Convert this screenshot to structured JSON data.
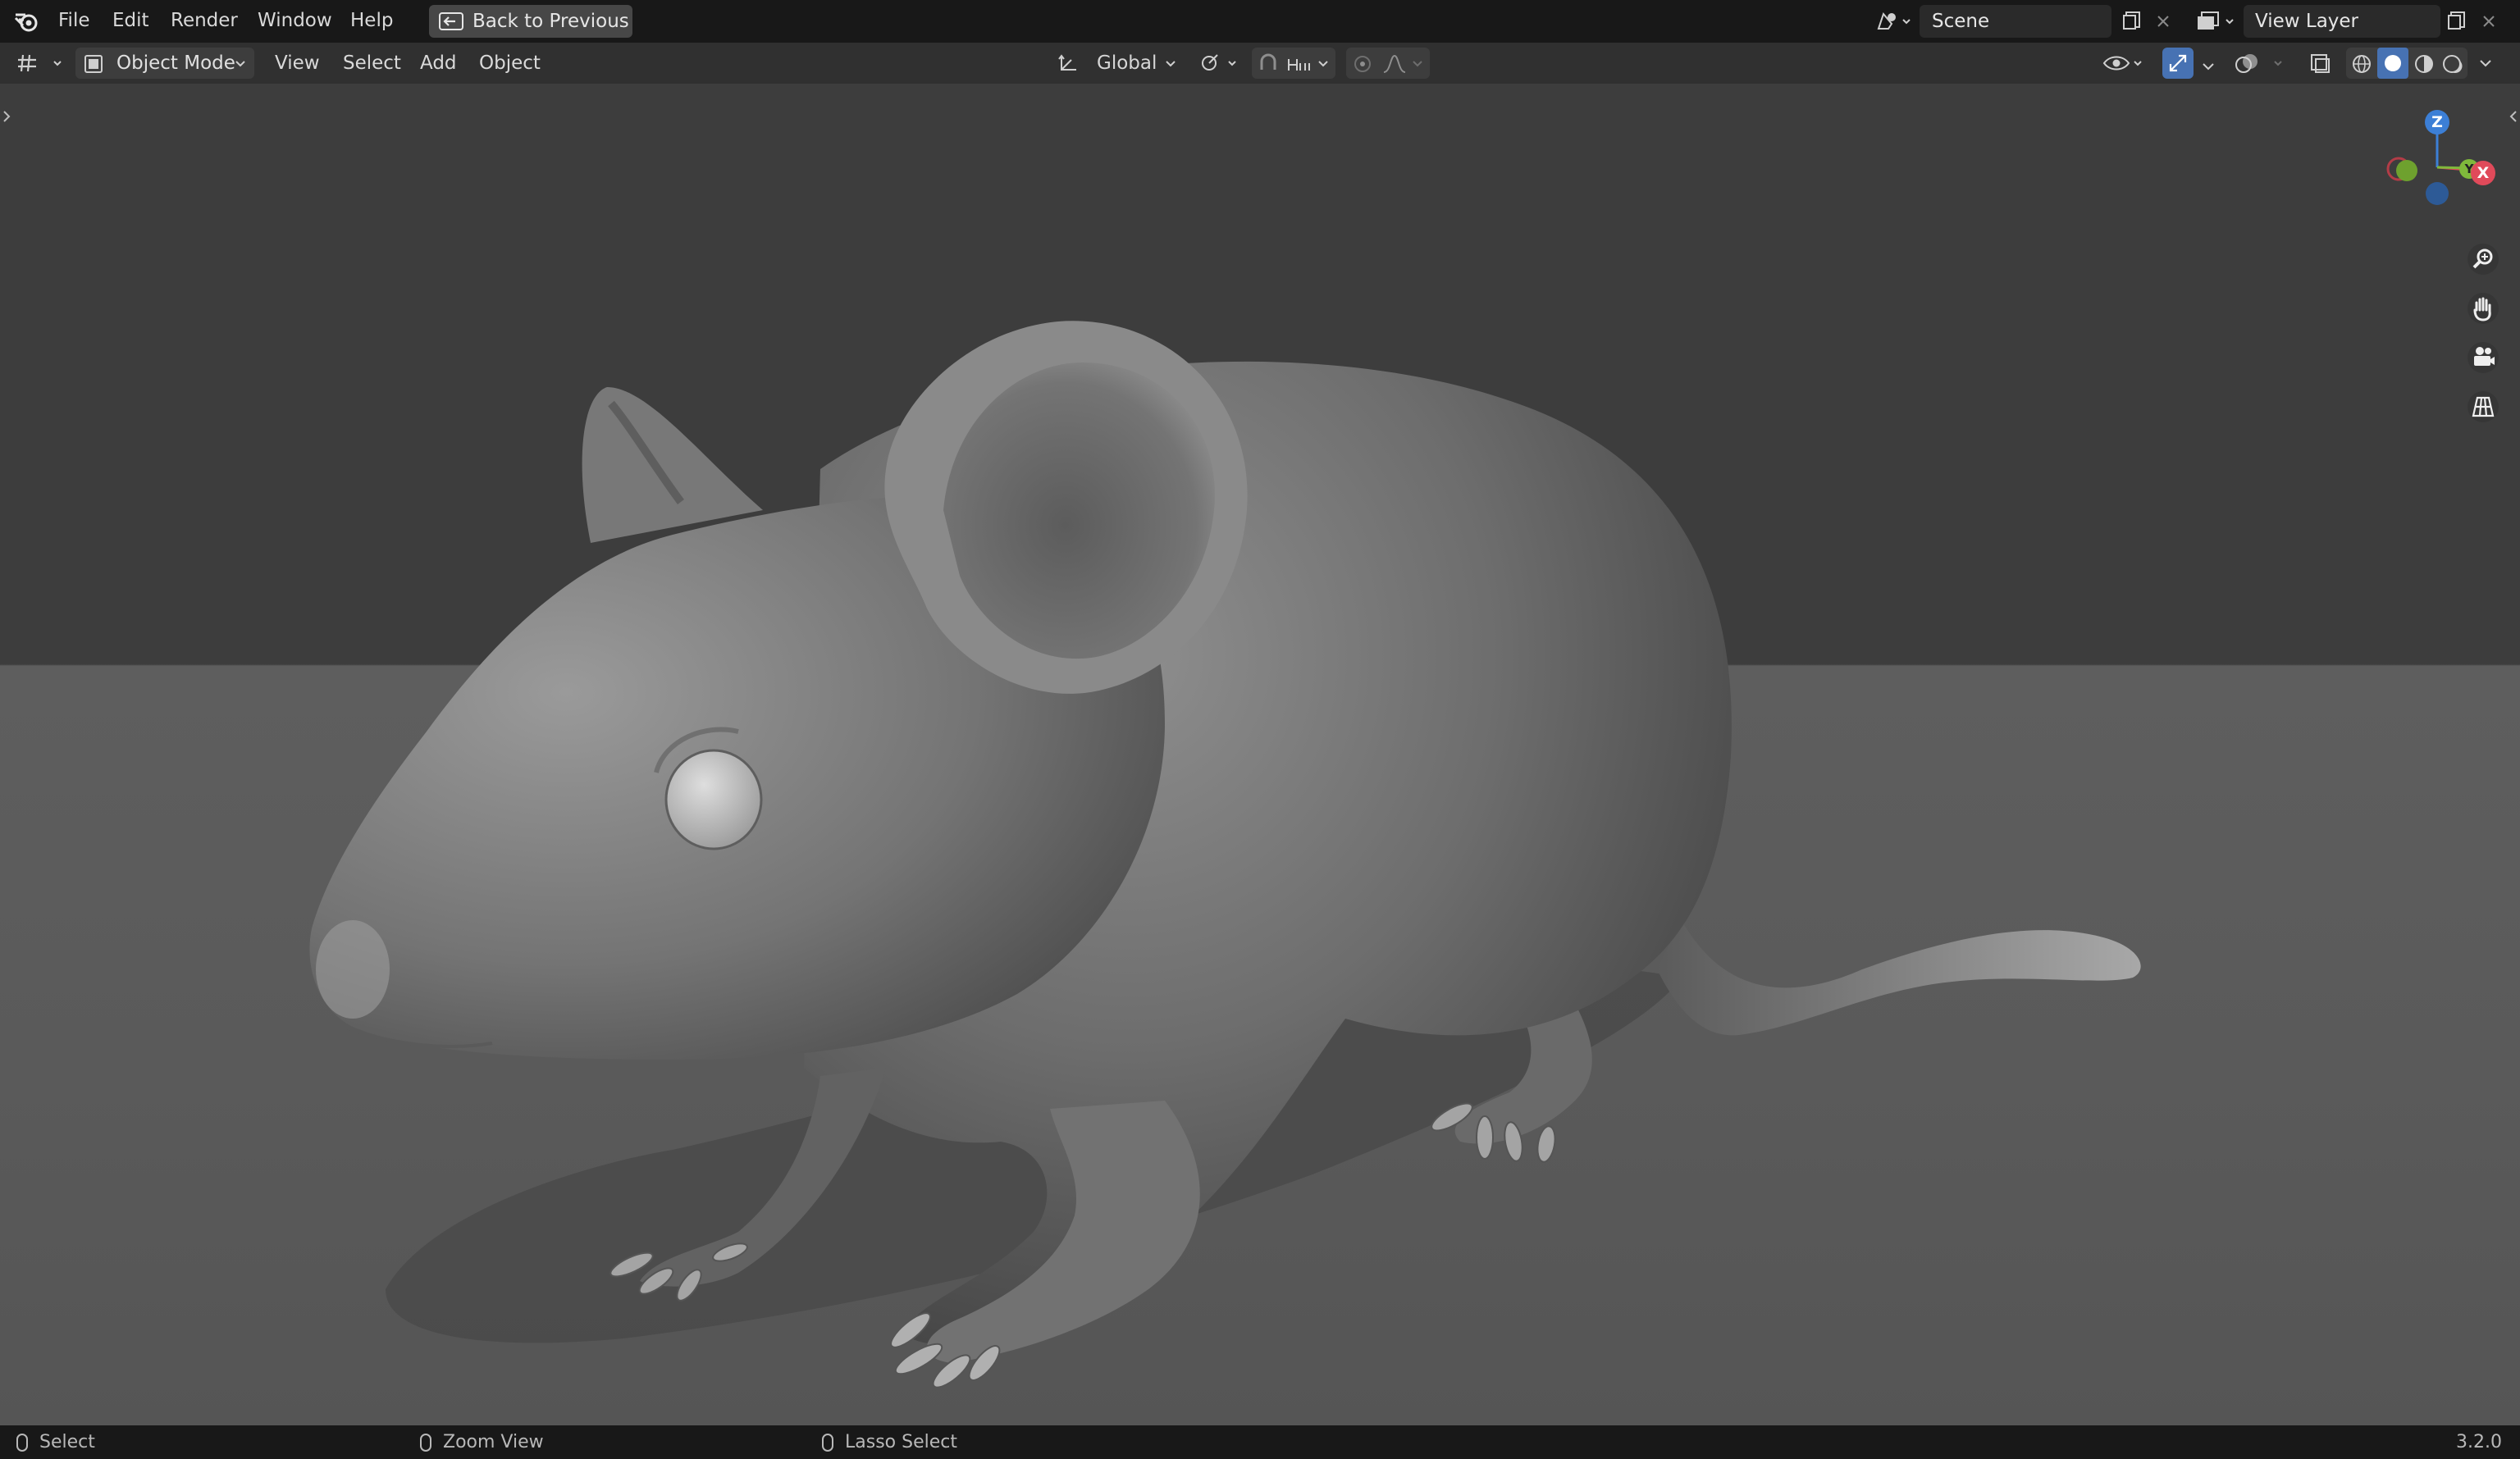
{
  "app": {
    "name": "Blender",
    "version": "3.2.0"
  },
  "topbar": {
    "menu": [
      "File",
      "Edit",
      "Render",
      "Window",
      "Help"
    ],
    "back_button": "Back to Previous",
    "scene_name": "Scene",
    "view_layer": "View Layer"
  },
  "header": {
    "mode": "Object Mode",
    "menu": [
      "View",
      "Select",
      "Add",
      "Object"
    ],
    "transform_orientation": "Global"
  },
  "navigation_gizmo": {
    "x": "X",
    "y": "Y",
    "z": "Z"
  },
  "statusbar": {
    "left": "Select",
    "middle": "Zoom View",
    "right": "Lasso Select"
  },
  "colors": {
    "axis_x": "#e04a5a",
    "axis_y": "#7fb93b",
    "axis_z": "#3c7fd6",
    "active_toggle": "#4772b3"
  }
}
